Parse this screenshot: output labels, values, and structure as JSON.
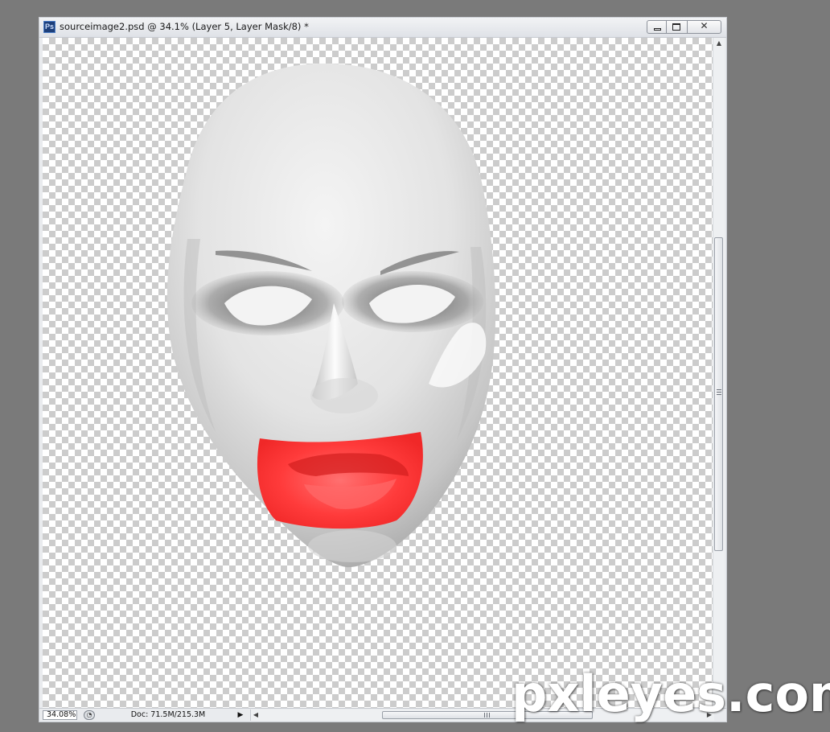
{
  "window": {
    "app_icon_label": "Ps",
    "title": "sourceimage2.psd @ 34.1% (Layer 5, Layer Mask/8) *",
    "close_glyph": "✕"
  },
  "canvas": {
    "image_subject": "white mask face with red lips"
  },
  "status_bar": {
    "zoom": "34.08%",
    "doc_info": "Doc: 71.5M/215.3M"
  },
  "icons": {
    "app": "photoshop-icon",
    "minimize": "minimize-icon",
    "maximize": "maximize-icon",
    "close": "close-icon",
    "status": "status-info-icon",
    "play": "play-arrow-icon"
  },
  "colors": {
    "lips": "#ff3b3b",
    "workspace": "#7a7a7a"
  },
  "watermark": "pxleyes.com"
}
